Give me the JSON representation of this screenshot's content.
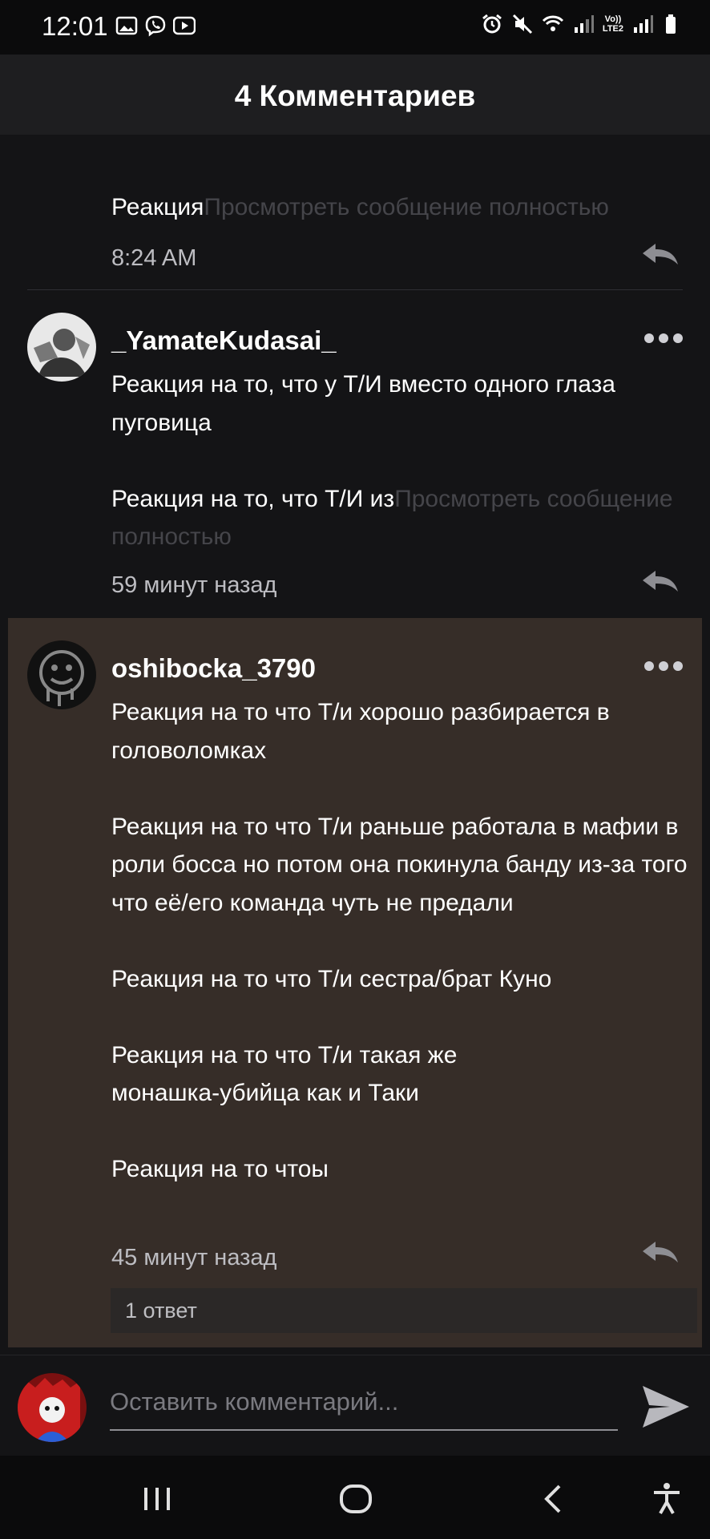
{
  "status_bar": {
    "time": "12:01",
    "left_icons": [
      "gallery-icon",
      "viber-icon",
      "youtube-icon"
    ],
    "right_icons": [
      "alarm-icon",
      "mute-icon",
      "wifi-icon",
      "signal-icon",
      "volte-icon",
      "signal-icon",
      "battery-icon"
    ],
    "volte_label": "Vo))\nLTE2"
  },
  "header": {
    "title": "4 Комментариев"
  },
  "comments": [
    {
      "text": "Реакция",
      "more_label": "Просмотреть сообщение полностью",
      "timestamp": "8:24 AM",
      "reply_icon": "reply-icon"
    },
    {
      "username": "_YamateKudasai_",
      "paragraphs": [
        "Реакция на то, что у Т/И вместо одного глаза пуговица",
        "Реакция на то, что Т/И из"
      ],
      "more_label": "Просмотреть сообщение полностью",
      "timestamp": "59 минут назад",
      "reply_icon": "reply-icon"
    },
    {
      "username": "oshibocka_3790",
      "paragraphs": [
        "Реакция на то что Т/и хорошо разбирается в головоломках",
        "Реакция на то что Т/и раньше работала в мафии в роли босса но потом она покинула банду из-за того что её/его команда чуть не предали",
        "Реакция на то что Т/и сестра/брат Куно",
        "Реакция на то что Т/и такая же монашка-убийца как и Таки",
        "Реакция на то чтоы"
      ],
      "timestamp": "45 минут назад",
      "replies_label": "1 ответ",
      "reply_icon": "reply-icon",
      "highlight_color": "#362d28"
    }
  ],
  "composer": {
    "placeholder": "Оставить комментарий...",
    "send_icon": "send-icon"
  },
  "nav_bar": {
    "buttons": [
      "recent-apps-icon",
      "home-icon",
      "back-icon",
      "accessibility-icon"
    ]
  },
  "colors": {
    "background": "#141416",
    "header": "#1e1e20",
    "highlight": "#362d28",
    "muted_text": "#45454a"
  }
}
